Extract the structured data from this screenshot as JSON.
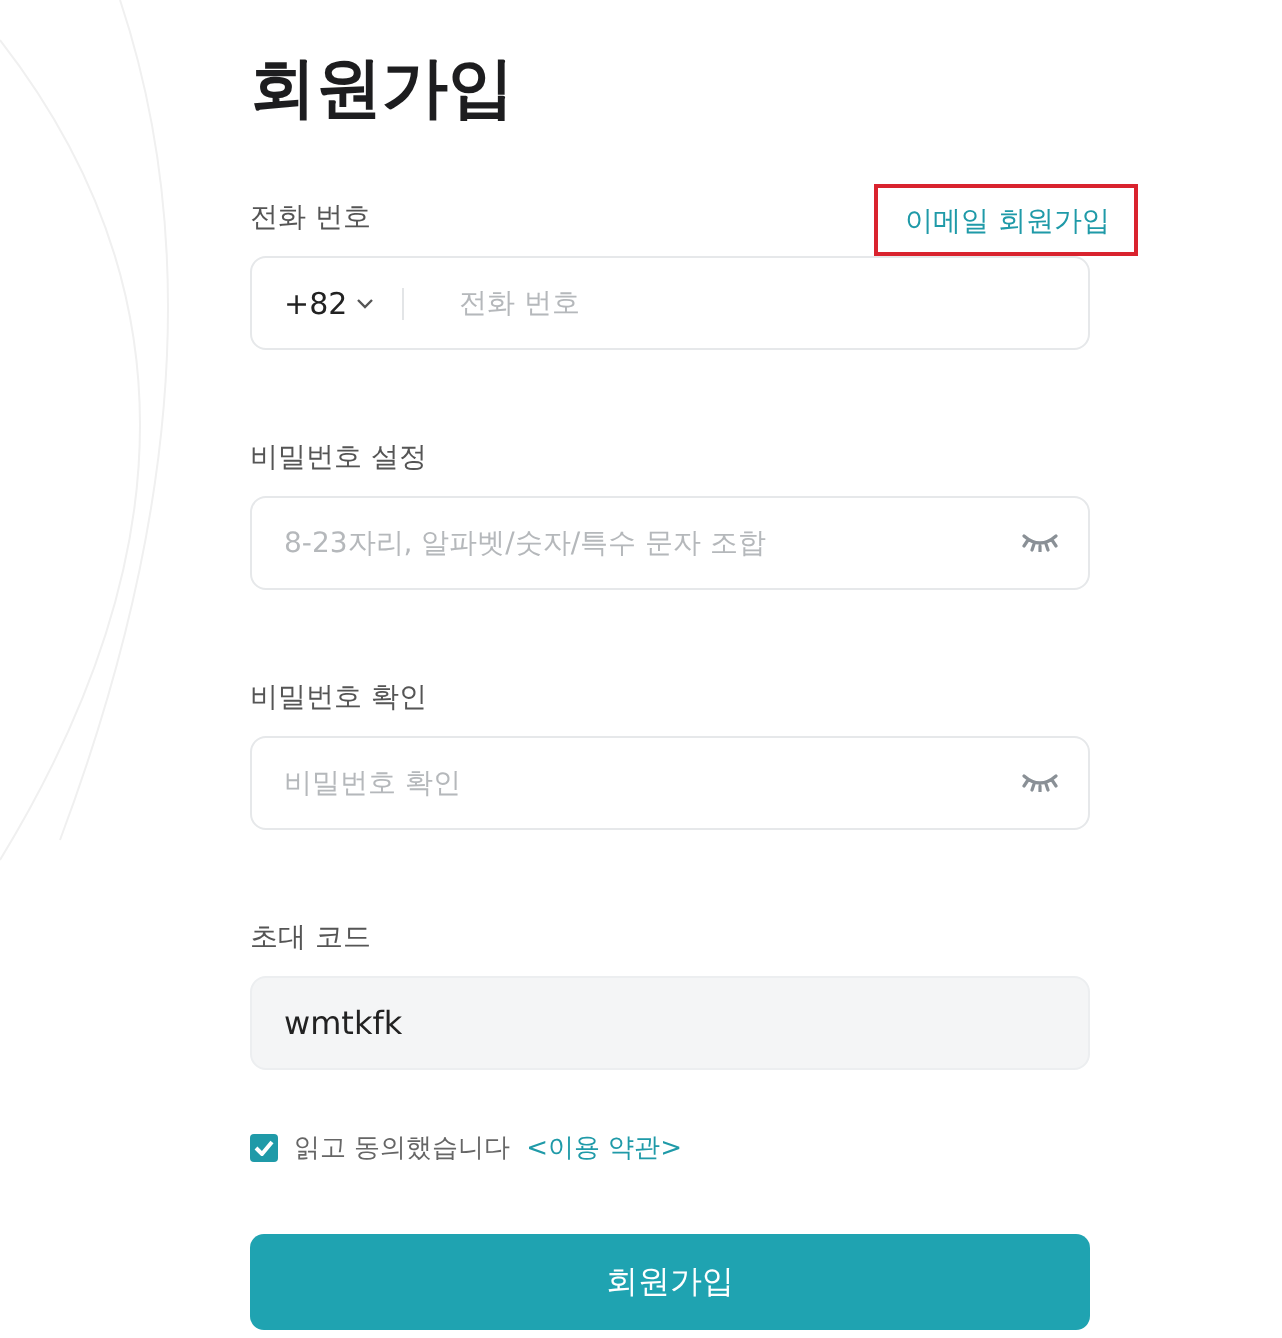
{
  "title": "회원가입",
  "email_signup_link": {
    "label": "이메일 회원가입",
    "highlighted": true
  },
  "fields": [
    {
      "kind": "phone",
      "label": "전화 번호",
      "country_code": "+82",
      "placeholder": "전화 번호"
    },
    {
      "kind": "password",
      "label": "비밀번호 설정",
      "placeholder": "8-23자리, 알파벳/숫자/특수 문자 조합"
    },
    {
      "kind": "password",
      "label": "비밀번호 확인",
      "placeholder": "비밀번호 확인"
    },
    {
      "kind": "text",
      "label": "초대 코드",
      "value": "wmtkfk"
    }
  ],
  "agreement": {
    "checked": true,
    "text": "읽고 동의했습니다",
    "link": "<이용 약관>"
  },
  "submit_button": "회원가입"
}
